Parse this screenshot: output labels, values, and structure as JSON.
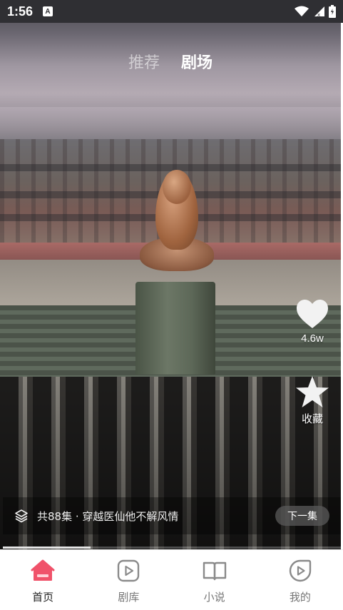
{
  "status_bar": {
    "time": "1:56",
    "notification_icon": "A"
  },
  "top_tabs": [
    {
      "label": "推荐",
      "active": false
    },
    {
      "label": "剧场",
      "active": true
    }
  ],
  "side_actions": {
    "like_count": "4.6w",
    "favorite_label": "收藏"
  },
  "episode_bar": {
    "text": "共88集 · 穿越医仙他不解风情",
    "next_button": "下一集"
  },
  "progress": 0.26,
  "bottom_nav": [
    {
      "label": "首页",
      "icon": "home-icon",
      "active": true
    },
    {
      "label": "剧库",
      "icon": "play-square-icon",
      "active": false
    },
    {
      "label": "小说",
      "icon": "book-icon",
      "active": false
    },
    {
      "label": "我的",
      "icon": "profile-play-icon",
      "active": false
    }
  ],
  "colors": {
    "accent": "#f0526a",
    "nav_icon": "#8a8a8a"
  }
}
